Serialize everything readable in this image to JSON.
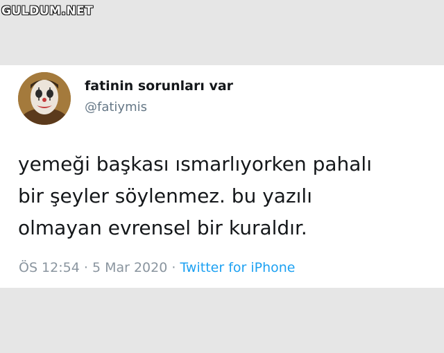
{
  "watermark": "GULDUM.NET",
  "tweet": {
    "display_name": "fatinin sorunları var",
    "handle": "@fatiymis",
    "text_lines": [
      "yemeği başkası ısmarlıyorken pahalı",
      "bir şeyler söylenmez. bu yazılı",
      "olmayan evrensel bir kuraldır."
    ],
    "time": "ÖS 12:54",
    "separator": "·",
    "date": "5 Mar 2020",
    "source": "Twitter for iPhone"
  },
  "colors": {
    "background": "#e6e6e6",
    "card": "#ffffff",
    "text": "#14171a",
    "secondary": "#657786",
    "link": "#1da1f2"
  },
  "icons": {
    "avatar": "clown-face-avatar"
  }
}
